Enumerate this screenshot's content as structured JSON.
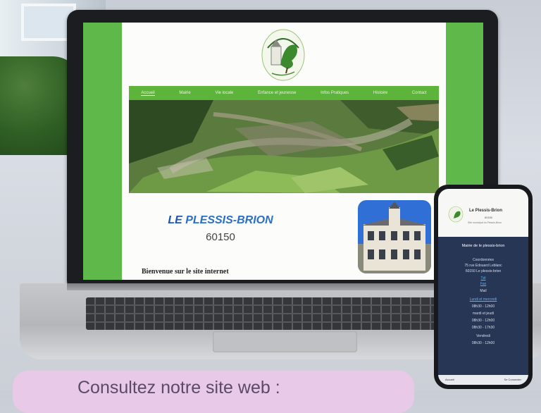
{
  "website": {
    "nav": [
      "Accueil",
      "Mairie",
      "Vie locale",
      "Enfance et jeunesse",
      "Infos Pratiques",
      "Histoire",
      "Contact"
    ],
    "title_prefix": "LE",
    "title_name": "PLESSIS-BRION",
    "postcode": "60150",
    "welcome": "Bienvenue sur le site internet"
  },
  "phone": {
    "title": "Le Plessis-Brion",
    "subtitle": "60150",
    "tagline": "Site municipal du Plessis-Brion",
    "heading": "Mairie de le plessis-brion",
    "lines": [
      "Coordonnées",
      "75 rue Edouard Leblanc",
      "60150 Le plessis-brion",
      "Tél",
      "Fax",
      "Mail",
      "Lundi et mercredi",
      "08h30 - 12h00",
      "mardi et jeudi",
      "08h30 - 12h00",
      "08h30 - 17h30",
      "Vendredi",
      "08h30 - 12h00"
    ],
    "footer_left": "Accueil",
    "footer_right": "Se Connecter"
  },
  "banner": {
    "text": "Consultez notre site web :"
  }
}
